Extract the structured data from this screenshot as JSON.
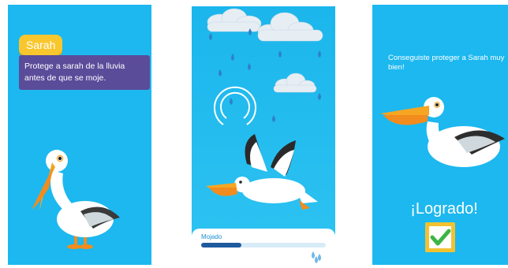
{
  "screen1": {
    "character_name": "Sarah",
    "instruction": "Protege a sarah de la lluvia antes de que se moje."
  },
  "screen2": {
    "wet_label": "Mojado",
    "wet_progress_percent": 32
  },
  "screen3": {
    "message": "Conseguiste proteger a Sarah muy bien!",
    "title": "¡Logrado!"
  },
  "colors": {
    "sky": "#1cb8ef",
    "dialog": "#5b4c9a",
    "tag": "#f9c72d",
    "check": "#3cb544"
  },
  "icons": [
    "pelican",
    "cloud",
    "raindrop",
    "shield-ring",
    "checkmark-icon"
  ]
}
